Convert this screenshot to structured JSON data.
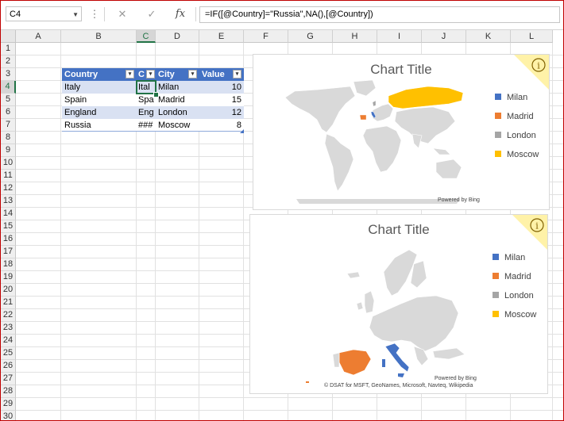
{
  "formula_bar": {
    "name_box": "C4",
    "formula": "=IF([@Country]=\"Russia\",NA(),[@Country])",
    "cancel_icon": "close-icon",
    "enter_icon": "check-icon",
    "function_icon": "fx-icon",
    "fx_label": "fx",
    "cancel_glyph": "✕",
    "enter_glyph": "✓",
    "more_glyph": "⋮"
  },
  "columns": [
    "A",
    "B",
    "C",
    "D",
    "E",
    "F",
    "G",
    "H",
    "I",
    "J",
    "K",
    "L"
  ],
  "rows": [
    "1",
    "2",
    "3",
    "4",
    "5",
    "6",
    "7",
    "8",
    "9",
    "10",
    "11",
    "12",
    "13",
    "14",
    "15",
    "16",
    "17",
    "18",
    "19",
    "20",
    "21",
    "22",
    "23",
    "24",
    "25",
    "26",
    "27",
    "28",
    "29",
    "30"
  ],
  "selected_cell": {
    "column": "C",
    "row": "4"
  },
  "table": {
    "headers": [
      "Country",
      "C",
      "City",
      "Value"
    ],
    "rows": [
      {
        "country": "Italy",
        "c": "Ital",
        "city": "Milan",
        "value": "10"
      },
      {
        "country": "Spain",
        "c": "Spa",
        "city": "Madrid",
        "value": "15"
      },
      {
        "country": "England",
        "c": "Eng",
        "city": "London",
        "value": "12"
      },
      {
        "country": "Russia",
        "c": "###",
        "city": "Moscow",
        "value": "8"
      }
    ]
  },
  "chart_data": [
    {
      "type": "map",
      "title": "Chart Title",
      "region": "world",
      "series": [
        {
          "name": "Milan",
          "country": "Italy",
          "color": "#4472c4"
        },
        {
          "name": "Madrid",
          "country": "Spain",
          "color": "#ed7d31"
        },
        {
          "name": "London",
          "country": "England",
          "color": "#a5a5a5"
        },
        {
          "name": "Moscow",
          "country": "Russia",
          "color": "#ffc000"
        }
      ],
      "attribution": "Powered by Bing",
      "legend_position": "right"
    },
    {
      "type": "map",
      "title": "Chart Title",
      "region": "europe",
      "series": [
        {
          "name": "Milan",
          "country": "Italy",
          "color": "#4472c4"
        },
        {
          "name": "Madrid",
          "country": "Spain",
          "color": "#ed7d31"
        },
        {
          "name": "London",
          "country": "England",
          "color": "#a5a5a5"
        },
        {
          "name": "Moscow",
          "country": "Russia",
          "color": "#ffc000"
        }
      ],
      "attribution": "Powered by Bing",
      "credits": "© DSAT for MSFT, GeoNames, Microsoft, Navteq, Wikipedia",
      "legend_position": "right"
    }
  ],
  "colors": {
    "table_header": "#4472c4",
    "table_band": "#d9e1f2",
    "selection": "#217346",
    "land": "#d9d9d9",
    "info_badge": "#fff2a8"
  }
}
